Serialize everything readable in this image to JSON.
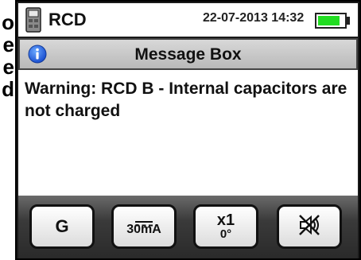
{
  "side_text": [
    "o",
    "e",
    "e",
    "d"
  ],
  "status": {
    "title": "RCD",
    "datetime": "22-07-2013 14:32",
    "battery_level": 0.85,
    "battery_color": "#22dd22"
  },
  "message_box": {
    "title": "Message Box",
    "text": "Warning: RCD B - Internal capacitors are not charged"
  },
  "buttons": {
    "g_label": "G",
    "range_label": "30mA",
    "mult_label": "x1",
    "angle_label": "0°",
    "sound_icon": "speaker-muted-icon"
  }
}
